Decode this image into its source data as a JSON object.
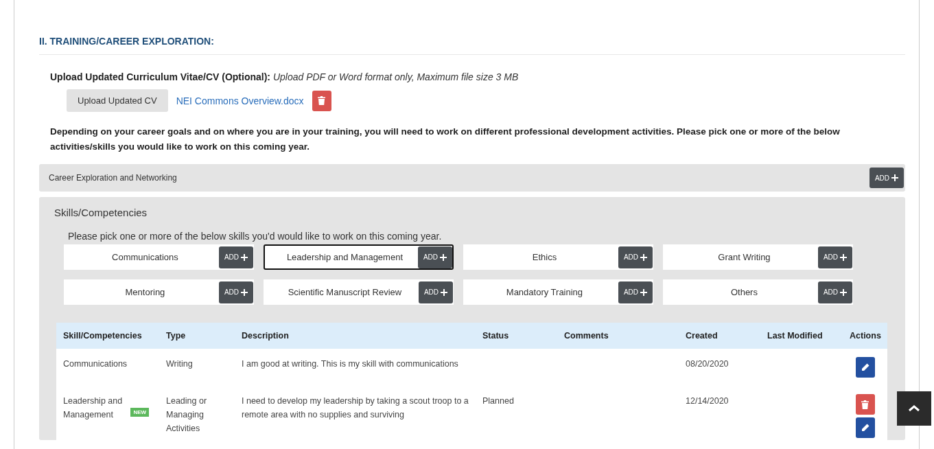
{
  "section_title": "II. TRAINING/CAREER EXPLORATION:",
  "upload": {
    "label": "Upload Updated Curriculum Vitae/CV (Optional):",
    "hint": "Upload PDF or Word format only, Maximum file size 3 MB",
    "button": "Upload Updated CV",
    "file_name": "NEI Commons Overview.docx"
  },
  "intro": "Depending on your career goals and on where you are in your training, you will need to work on different professional development activities. Please pick one or more of the below activities/skills you would like to work on this coming year.",
  "career_panel": {
    "title": "Career Exploration and Networking",
    "add_label": "ADD"
  },
  "skills_panel": {
    "title": "Skills/Competencies",
    "prompt": "Please pick one or more of the below skills you'd would like to work on this coming year.",
    "skills": [
      {
        "label": "Communications",
        "add_label": "ADD",
        "selected": false
      },
      {
        "label": "Leadership and Management",
        "add_label": "ADD",
        "selected": true
      },
      {
        "label": "Ethics",
        "add_label": "ADD",
        "selected": false
      },
      {
        "label": "Grant Writing",
        "add_label": "ADD",
        "selected": false
      },
      {
        "label": "Mentoring",
        "add_label": "ADD",
        "selected": false
      },
      {
        "label": "Scientific Manuscript Review",
        "add_label": "ADD",
        "selected": false
      },
      {
        "label": "Mandatory Training",
        "add_label": "ADD",
        "selected": false
      },
      {
        "label": "Others",
        "add_label": "ADD",
        "selected": false
      }
    ]
  },
  "table": {
    "columns": [
      "Skill/Competencies",
      "Type",
      "Description",
      "Status",
      "Comments",
      "Created",
      "Last Modified",
      "Actions"
    ],
    "rows": [
      {
        "skill": "Communications",
        "type": "Writing",
        "description": "I am good at writing. This is my skill with communications",
        "created": "08/20/2020",
        "actions": [
          {
            "kind": "edit"
          }
        ]
      },
      {
        "skill": "Leadership and Management",
        "badge": "NEW",
        "type": "Leading or Managing Activities",
        "description": "I need to develop my leadership by taking a scout troop to a remote area with no supplies and surviving",
        "status": "Planned",
        "created": "12/14/2020",
        "actions": [
          {
            "kind": "delete"
          },
          {
            "kind": "edit"
          }
        ]
      }
    ]
  }
}
